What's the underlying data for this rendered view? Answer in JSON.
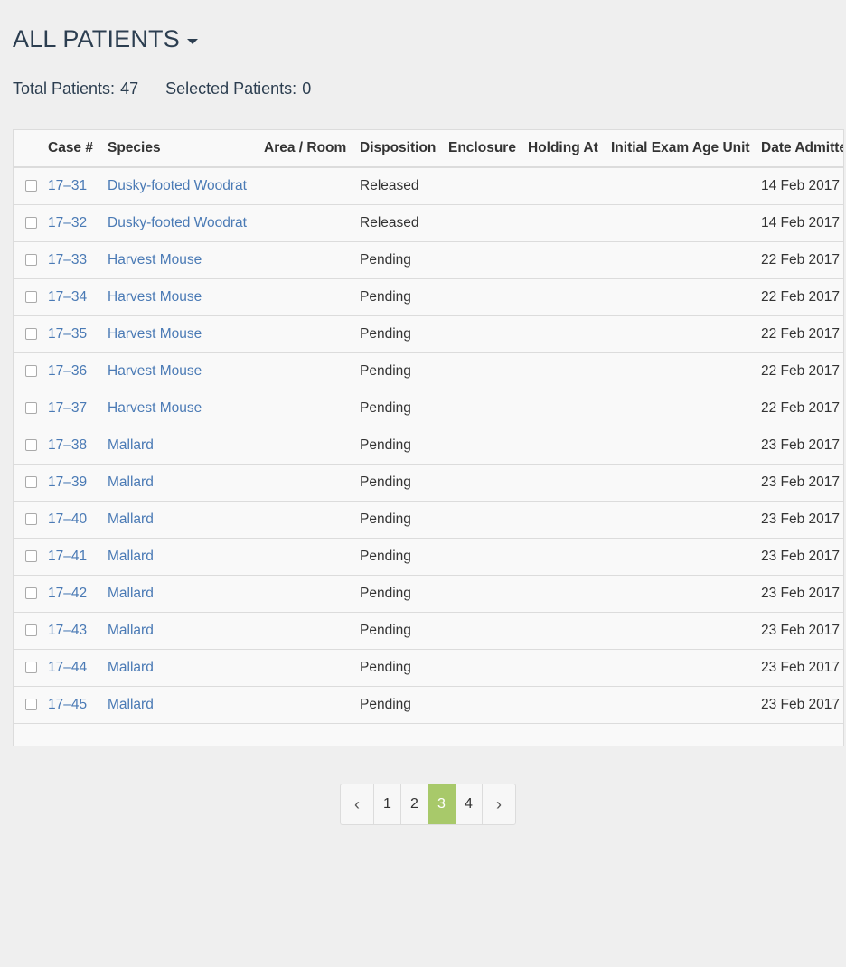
{
  "header": {
    "title": "ALL PATIENTS"
  },
  "stats": {
    "total_label": "Total Patients:",
    "total_value": "47",
    "selected_label": "Selected Patients:",
    "selected_value": "0"
  },
  "table": {
    "columns": [
      "Case #",
      "Species",
      "Area / Room",
      "Disposition",
      "Enclosure",
      "Holding At",
      "Initial Exam Age Unit",
      "Date Admitted"
    ],
    "rows": [
      {
        "case": "17–31",
        "species": "Dusky-footed Woodrat",
        "area": "",
        "disposition": "Released",
        "enclosure": "",
        "holding": "",
        "age_unit": "",
        "date": "14 Feb 2017"
      },
      {
        "case": "17–32",
        "species": "Dusky-footed Woodrat",
        "area": "",
        "disposition": "Released",
        "enclosure": "",
        "holding": "",
        "age_unit": "",
        "date": "14 Feb 2017"
      },
      {
        "case": "17–33",
        "species": "Harvest Mouse",
        "area": "",
        "disposition": "Pending",
        "enclosure": "",
        "holding": "",
        "age_unit": "",
        "date": "22 Feb 2017"
      },
      {
        "case": "17–34",
        "species": "Harvest Mouse",
        "area": "",
        "disposition": "Pending",
        "enclosure": "",
        "holding": "",
        "age_unit": "",
        "date": "22 Feb 2017"
      },
      {
        "case": "17–35",
        "species": "Harvest Mouse",
        "area": "",
        "disposition": "Pending",
        "enclosure": "",
        "holding": "",
        "age_unit": "",
        "date": "22 Feb 2017"
      },
      {
        "case": "17–36",
        "species": "Harvest Mouse",
        "area": "",
        "disposition": "Pending",
        "enclosure": "",
        "holding": "",
        "age_unit": "",
        "date": "22 Feb 2017"
      },
      {
        "case": "17–37",
        "species": "Harvest Mouse",
        "area": "",
        "disposition": "Pending",
        "enclosure": "",
        "holding": "",
        "age_unit": "",
        "date": "22 Feb 2017"
      },
      {
        "case": "17–38",
        "species": "Mallard",
        "area": "",
        "disposition": "Pending",
        "enclosure": "",
        "holding": "",
        "age_unit": "",
        "date": "23 Feb 2017"
      },
      {
        "case": "17–39",
        "species": "Mallard",
        "area": "",
        "disposition": "Pending",
        "enclosure": "",
        "holding": "",
        "age_unit": "",
        "date": "23 Feb 2017"
      },
      {
        "case": "17–40",
        "species": "Mallard",
        "area": "",
        "disposition": "Pending",
        "enclosure": "",
        "holding": "",
        "age_unit": "",
        "date": "23 Feb 2017"
      },
      {
        "case": "17–41",
        "species": "Mallard",
        "area": "",
        "disposition": "Pending",
        "enclosure": "",
        "holding": "",
        "age_unit": "",
        "date": "23 Feb 2017"
      },
      {
        "case": "17–42",
        "species": "Mallard",
        "area": "",
        "disposition": "Pending",
        "enclosure": "",
        "holding": "",
        "age_unit": "",
        "date": "23 Feb 2017"
      },
      {
        "case": "17–43",
        "species": "Mallard",
        "area": "",
        "disposition": "Pending",
        "enclosure": "",
        "holding": "",
        "age_unit": "",
        "date": "23 Feb 2017"
      },
      {
        "case": "17–44",
        "species": "Mallard",
        "area": "",
        "disposition": "Pending",
        "enclosure": "",
        "holding": "",
        "age_unit": "",
        "date": "23 Feb 2017"
      },
      {
        "case": "17–45",
        "species": "Mallard",
        "area": "",
        "disposition": "Pending",
        "enclosure": "",
        "holding": "",
        "age_unit": "",
        "date": "23 Feb 2017"
      }
    ]
  },
  "pagination": {
    "prev_icon": "‹",
    "next_icon": "›",
    "pages": [
      "1",
      "2",
      "3",
      "4"
    ],
    "active_page": "3"
  },
  "colors": {
    "accent": "#a8c96a",
    "link": "#4a7ab5",
    "title": "#2c3e50"
  }
}
